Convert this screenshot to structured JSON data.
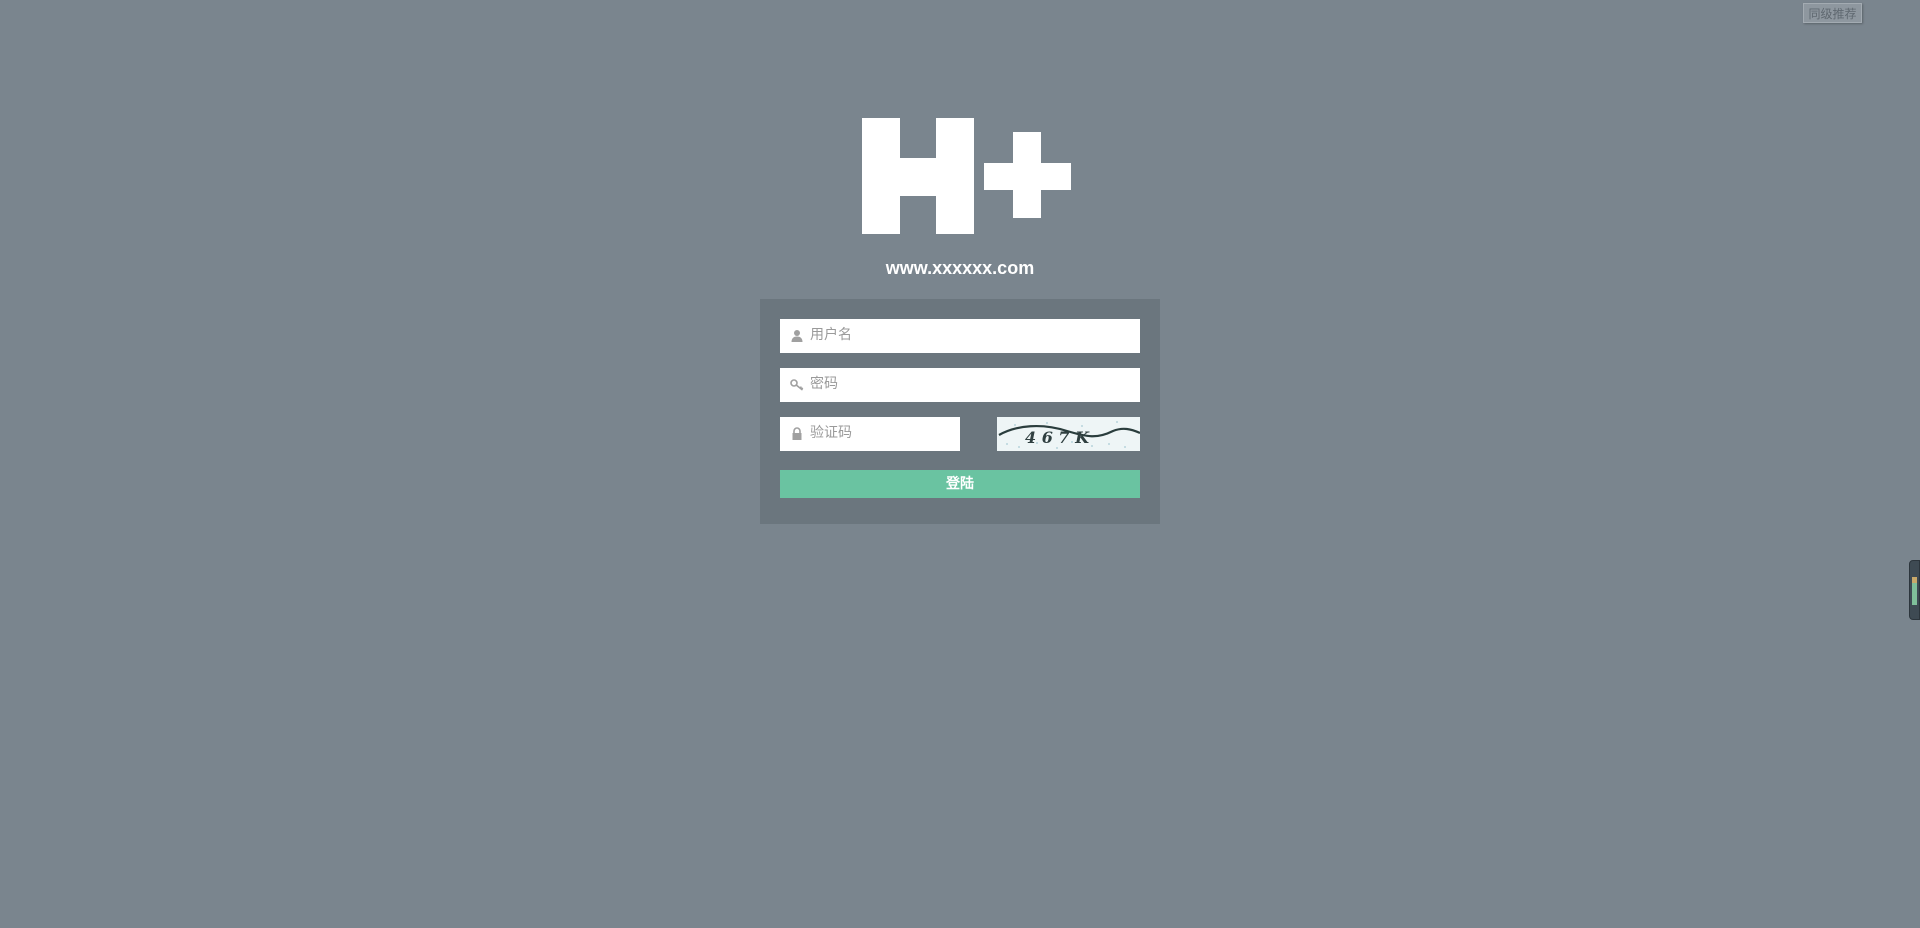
{
  "header": {
    "corner_button_label": "同级推荐"
  },
  "logo": {
    "text": "H+"
  },
  "site": {
    "url": "www.xxxxxx.com"
  },
  "form": {
    "username_placeholder": "用户名",
    "password_placeholder": "密码",
    "captcha_placeholder": "验证码",
    "captcha_text": "4 6 7 K",
    "submit_label": "登陆"
  },
  "icons": {
    "username": "user-icon",
    "password": "key-icon",
    "captcha": "lock-icon"
  },
  "colors": {
    "background": "#7a858e",
    "panel": "#6b767e",
    "button": "#6ac3a1",
    "text": "#ffffff"
  }
}
